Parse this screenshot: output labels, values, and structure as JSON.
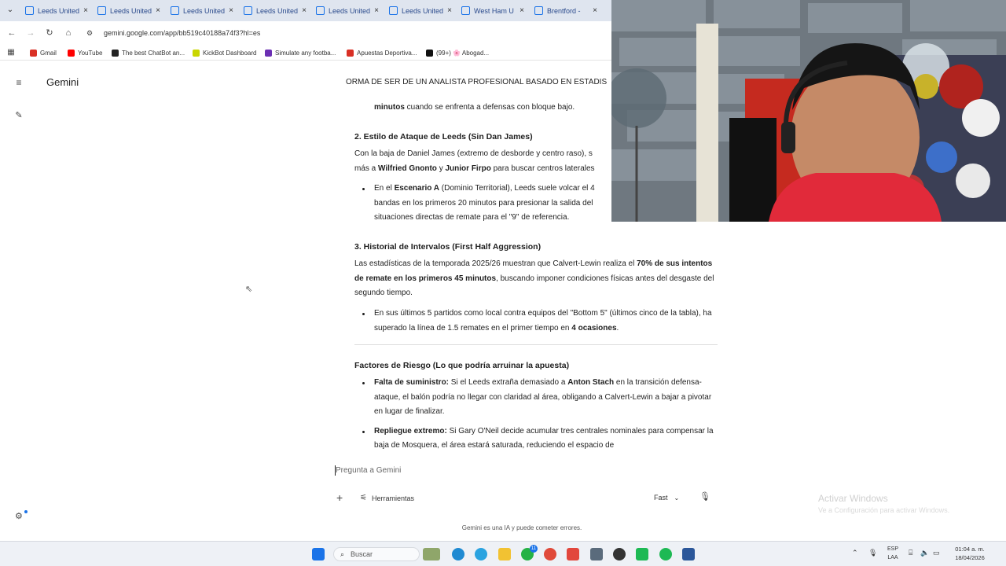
{
  "browser": {
    "tabs": [
      {
        "label": "Leeds United"
      },
      {
        "label": "Leeds United"
      },
      {
        "label": "Leeds United"
      },
      {
        "label": "Leeds United"
      },
      {
        "label": "Leeds United"
      },
      {
        "label": "Leeds United"
      },
      {
        "label": "West Ham U"
      },
      {
        "label": "Brentford -"
      }
    ],
    "url": "gemini.google.com/app/bb519c40188a74f3?hl=es",
    "bookmarks": [
      {
        "label": "Gmail",
        "color": "#d93025"
      },
      {
        "label": "YouTube",
        "color": "#ff0000"
      },
      {
        "label": "The best ChatBot an...",
        "color": "#222222"
      },
      {
        "label": "KickBot Dashboard",
        "color": "#c9d600"
      },
      {
        "label": "Simulate any footba...",
        "color": "#6b2fb3"
      },
      {
        "label": "Apuestas Deportiva...",
        "color": "#d93025"
      },
      {
        "label": "(99+) 🌸 Abogad...",
        "color": "#111111"
      }
    ]
  },
  "app": {
    "brand": "Gemini"
  },
  "response": {
    "header_line": "ORMA DE SER DE UN ANALISTA PROFESIONAL BASADO EN ESTADIS",
    "cont_bold": "minutos",
    "cont_rest": " cuando se enfrenta a defensas con bloque bajo.",
    "s2_title": "2. Estilo de Ataque de Leeds (Sin Dan James)",
    "s2_p_a": "Con la baja de Daniel James (extremo de desborde y centro raso), s",
    "s2_p_b": "más a ",
    "s2_p_c": "Wilfried Gnonto",
    "s2_p_d": " y ",
    "s2_p_e": "Junior Firpo",
    "s2_p_f": " para buscar centros laterales",
    "s2_li_a": "En el ",
    "s2_li_b": "Escenario A",
    "s2_li_c": " (Dominio Territorial), Leeds suele volcar el 4",
    "s2_li_d": "bandas en los primeros 20 minutos para presionar la salida del",
    "s2_li_e": "situaciones directas de remate para el \"9\" de referencia.",
    "s3_title": "3. Historial de Intervalos (First Half Aggression)",
    "s3_p_a": "Las estadísticas de la temporada 2025/26 muestran que Calvert-Lewin realiza el ",
    "s3_p_b": "70% de sus intentos de remate en los primeros 45 minutos",
    "s3_p_c": ", buscando imponer condiciones físicas antes del desgaste del segundo tiempo.",
    "s3_li_a": "En sus últimos 5 partidos como local contra equipos del \"Bottom 5\" (últimos cinco de la tabla), ha superado la línea de 1.5 remates en el primer tiempo en ",
    "s3_li_b": "4 ocasiones",
    "s3_li_c": ".",
    "risk_title": "Factores de Riesgo (Lo que podría arruinar la apuesta)",
    "r1_a": "Falta de suministro:",
    "r1_b": " Si el Leeds extraña demasiado a ",
    "r1_c": "Anton Stach",
    "r1_d": " en la transición defensa-ataque, el balón podría no llegar con claridad al área, obligando a Calvert-Lewin a bajar a pivotar en lugar de finalizar.",
    "r2_a": "Repliegue extremo:",
    "r2_b": " Si Gary O'Neil decide acumular tres centrales nominales para compensar la baja de Mosquera, el área estará saturada, reduciendo el espacio de"
  },
  "input": {
    "placeholder": "Pregunta a Gemini",
    "tools_label": "Herramientas",
    "mode_label": "Fast"
  },
  "disclaimer": "Gemini es una IA y puede cometer errores.",
  "watermark": {
    "title": "Activar Windows",
    "subtitle": "Ve a Configuración para activar Windows."
  },
  "taskbar": {
    "search_placeholder": "Buscar",
    "lang_top": "ESP",
    "lang_bottom": "LAA",
    "time": "01:04 a. m.",
    "date": "18/04/2026",
    "whatsapp_badge": "11"
  }
}
